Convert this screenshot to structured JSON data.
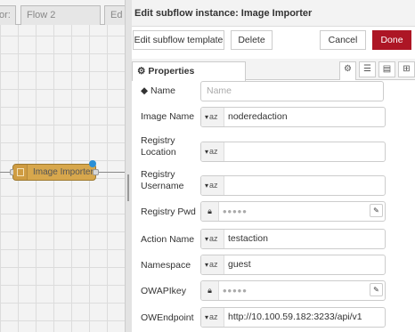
{
  "workspace": {
    "tabs": [
      "or:",
      "Flow 2",
      "Ed"
    ],
    "node": {
      "label": "Image Importer",
      "color": "#d7a74c"
    }
  },
  "editor": {
    "title": "Edit subflow instance: Image Importer",
    "buttons": {
      "edit_template": "Edit subflow template",
      "delete": "Delete",
      "cancel": "Cancel",
      "done": "Done"
    },
    "tab": {
      "label": "Properties",
      "icon": "gear-icon"
    },
    "tab_icons": [
      "gear-icon",
      "list-icon",
      "document-icon",
      "layout-icon"
    ],
    "fields": {
      "name": {
        "label": "Name",
        "placeholder": "Name",
        "icon": "tag-icon"
      },
      "image_name": {
        "label": "Image Name",
        "type": "string",
        "value": "noderedaction"
      },
      "registry_location": {
        "label": "Registry Location",
        "type": "string",
        "value": ""
      },
      "registry_username": {
        "label": "Registry Username",
        "type": "string",
        "value": ""
      },
      "registry_pwd": {
        "label": "Registry Pwd",
        "type": "credential",
        "value": "•••••"
      },
      "action_name": {
        "label": "Action Name",
        "type": "string",
        "value": "testaction"
      },
      "namespace": {
        "label": "Namespace",
        "type": "string",
        "value": "guest"
      },
      "owapikey": {
        "label": "OWAPIkey",
        "type": "credential",
        "value": "•••••"
      },
      "owendpoint": {
        "label": "OWEndpoint",
        "type": "string",
        "value": "http://10.100.59.182:3233/api/v1"
      }
    },
    "type_symbol": "az",
    "accent_color": "#ad1625"
  }
}
